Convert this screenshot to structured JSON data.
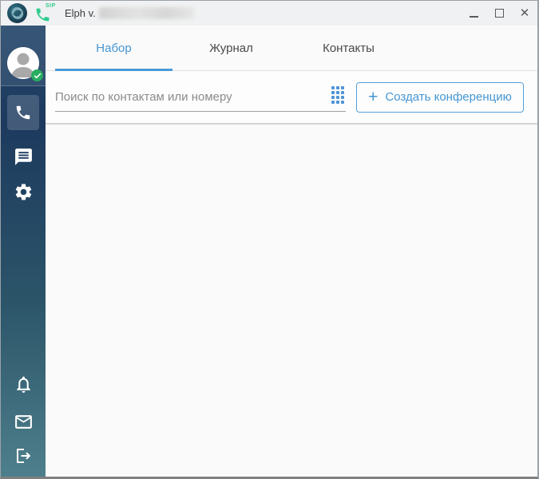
{
  "titlebar": {
    "app_title": "Elph v.",
    "sip_badge": "SIP",
    "close_glyph": "✕"
  },
  "tabs": {
    "items": [
      {
        "label": "Набор",
        "active": true
      },
      {
        "label": "Журнал",
        "active": false
      },
      {
        "label": "Контакты",
        "active": false
      }
    ]
  },
  "toolbar": {
    "search_placeholder": "Поиск по контактам или номеру",
    "create_conference": {
      "plus": "+",
      "label": "Создать конференцию"
    }
  },
  "sidebar": {
    "user_status": "online",
    "nav_items": [
      {
        "id": "calls",
        "icon": "phone-icon",
        "active": true
      },
      {
        "id": "chats",
        "icon": "chat-icon",
        "active": false
      },
      {
        "id": "settings",
        "icon": "gear-icon",
        "active": false
      }
    ],
    "footer_items": [
      {
        "id": "notifications",
        "icon": "bell-icon"
      },
      {
        "id": "mail",
        "icon": "mail-icon"
      },
      {
        "id": "logout",
        "icon": "logout-icon"
      }
    ]
  },
  "colors": {
    "accent_blue": "#4596d3",
    "tab_underline": "#4a9ad8",
    "sip_green": "#2ecc8e",
    "status_green": "#27ae60",
    "sidebar_top": "#24466a",
    "sidebar_bottom": "#4e7f8c",
    "titlebar_bg": "#f0f1f2"
  }
}
